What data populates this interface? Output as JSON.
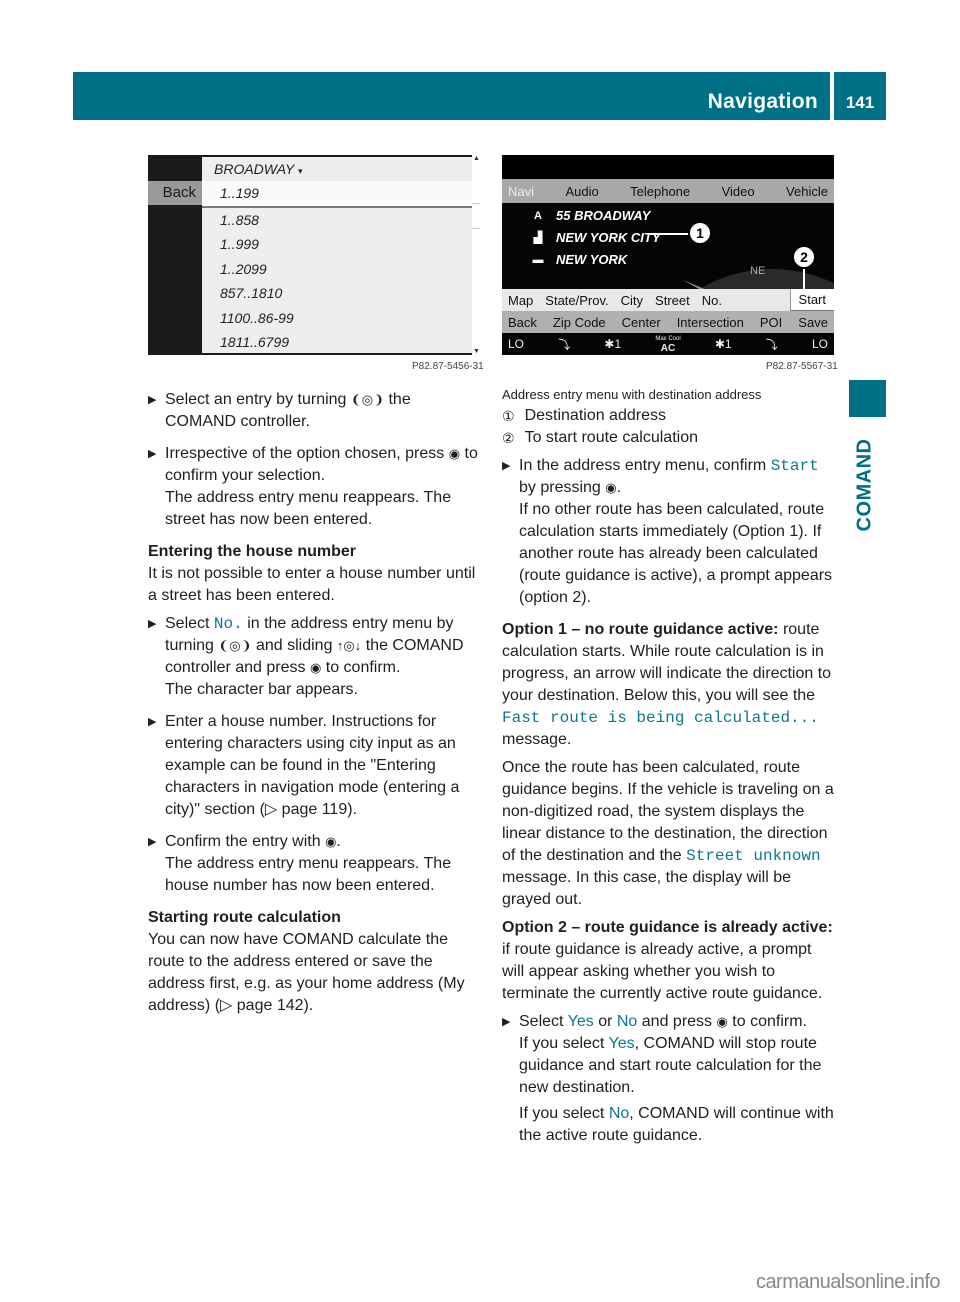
{
  "header": {
    "section_title": "Navigation",
    "page_number": "141",
    "side_tab": "COMAND"
  },
  "figure1": {
    "back_label": "Back",
    "list_title": "BROADWAY",
    "dropdown_icon": "chevron-down-small",
    "rows": [
      "1..199",
      "1..858",
      "1..999",
      "1..2099",
      "857..1810",
      "1100..86-99",
      "1811..6799"
    ],
    "selected_row": "1..199",
    "code": "P82.87-5456-31"
  },
  "figure2": {
    "top_nav": [
      "Navi",
      "Audio",
      "Telephone",
      "Video",
      "Vehicle"
    ],
    "active_tab": "Navi",
    "destination": [
      {
        "icon": "street-icon",
        "glyph": "A",
        "text": "55 BROADWAY"
      },
      {
        "icon": "city-icon",
        "glyph": "▟",
        "text": "NEW YORK CITY"
      },
      {
        "icon": "state-icon",
        "glyph": "▬",
        "text": "NEW YORK"
      }
    ],
    "compass_label": "NE",
    "address_menu": [
      "Map",
      "State/Prov.",
      "City",
      "Street",
      "No."
    ],
    "start_label": "Start",
    "command_bar": [
      "Back",
      "Zip Code",
      "Center",
      "Intersection",
      "POI",
      "Save"
    ],
    "climate_bar": {
      "left_temp": "LO",
      "left_fan": "✱1",
      "ac_top": "Max Cool",
      "ac_bottom": "AC",
      "right_fan": "✱1",
      "right_temp": "LO"
    },
    "callouts": [
      "1",
      "2"
    ],
    "code": "P82.87-5567-31"
  },
  "left_column": {
    "step1_a": "Select an entry by turning",
    "step1_b": "the COMAND controller.",
    "step2_a": "Irrespective of the option chosen, press",
    "step2_b": "to confirm your selection.",
    "step2_result": "The address entry menu reappears. The street has now been entered.",
    "heading_house": "Entering the house number",
    "house_intro": "It is not possible to enter a house number until a street has been entered.",
    "step3_a": "Select",
    "step3_link": "No.",
    "step3_b": "in the address entry menu by turning",
    "step3_c": "and sliding",
    "step3_d": "the COMAND controller and press",
    "step3_e": "to confirm.",
    "step3_result": "The character bar appears.",
    "step4": "Enter a house number. Instructions for entering characters using city input as an example can be found in the \"Entering characters in navigation mode (entering a city)\" section (▷ page 119).",
    "step5_a": "Confirm the entry with",
    "step5_b": ".",
    "step5_result": "The address entry menu reappears. The house number has now been entered.",
    "heading_route": "Starting route calculation",
    "route_intro": "You can now have COMAND calculate the route to the address entered or save the address first, e.g. as your home address (My address) (▷ page 142)."
  },
  "right_column": {
    "caption": "Address entry menu with destination address",
    "legend": [
      {
        "num": "①",
        "text": "Destination address"
      },
      {
        "num": "②",
        "text": "To start route calculation"
      }
    ],
    "step1_a": "In the address entry menu, confirm",
    "step1_link": "Start",
    "step1_b": "by pressing",
    "step1_c": ".",
    "step1_result": "If no other route has been calculated, route calculation starts immediately (Option 1). If another route has already been calculated (route guidance is active), a prompt appears (option 2).",
    "opt1_bold": "Option 1 – no route guidance active:",
    "opt1_a": "route calculation starts. While route calculation is in progress, an arrow will indicate the direction to your destination. Below this, you will see the",
    "opt1_link": "Fast route is being calculated...",
    "opt1_b": "message.",
    "opt1_p2_a": "Once the route has been calculated, route guidance begins. If the vehicle is traveling on a non-digitized road, the system displays the linear distance to the destination, the direction of the destination and the",
    "opt1_p2_link": "Street unknown",
    "opt1_p2_b": "message. In this case, the display will be grayed out.",
    "opt2_bold": "Option 2 – route guidance is already active:",
    "opt2_text": "if route guidance is already active, a prompt will appear asking whether you wish to terminate the currently active route guidance.",
    "step2_a": "Select",
    "step2_yes": "Yes",
    "step2_or": "or",
    "step2_no": "No",
    "step2_b": "and press",
    "step2_c": "to confirm.",
    "yes_a": "If you select",
    "yes_link": "Yes",
    "yes_b": ", COMAND will stop route guidance and start route calculation for the new destination.",
    "no_a": "If you select",
    "no_link": "No",
    "no_b": ", COMAND will continue with the active route guidance."
  },
  "symbols": {
    "turn": "❨◎❩",
    "slide": "↑◎↓",
    "press": "◉",
    "bullet": "▶"
  },
  "watermark": "carmanualsonline.info"
}
